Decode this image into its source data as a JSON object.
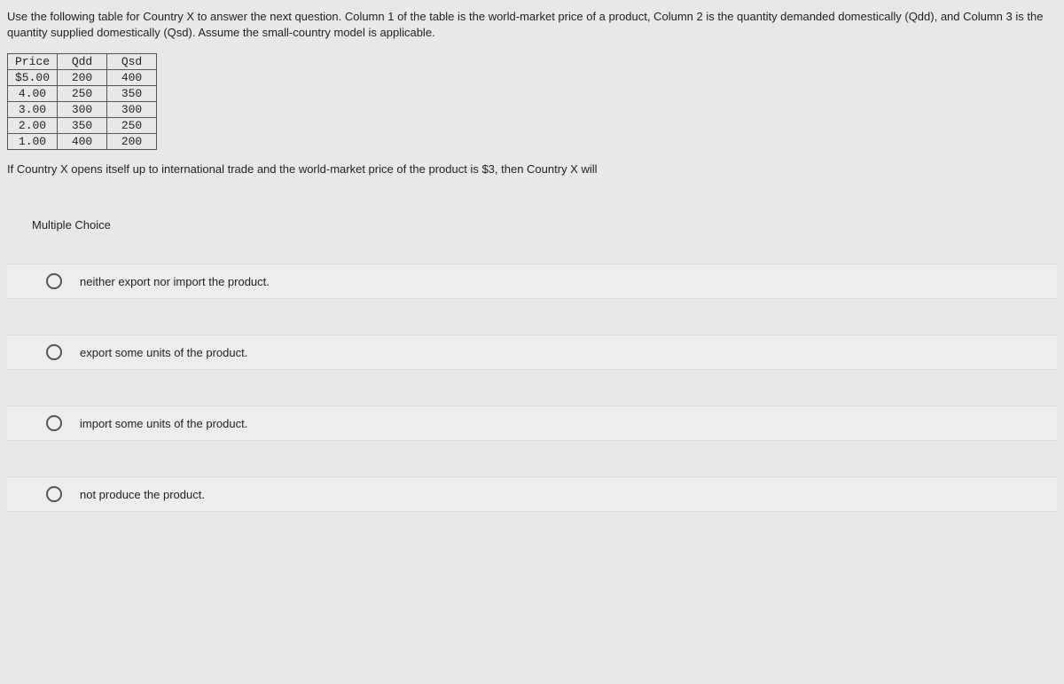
{
  "intro": "Use the following table for Country X to answer the next question. Column 1 of the table is the world-market price of a product, Column 2 is the quantity demanded domestically (Qdd), and Column 3 is the quantity supplied domestically (Qsd). Assume the small-country model is applicable.",
  "table": {
    "headers": [
      "Price",
      "Qdd",
      "Qsd"
    ],
    "rows": [
      [
        "$5.00",
        "200",
        "400"
      ],
      [
        "4.00",
        "250",
        "350"
      ],
      [
        "3.00",
        "300",
        "300"
      ],
      [
        "2.00",
        "350",
        "250"
      ],
      [
        "1.00",
        "400",
        "200"
      ]
    ]
  },
  "followup": "If Country X opens itself up to international trade and the world-market price of the product is $3, then Country X will",
  "mc_label": "Multiple Choice",
  "options": [
    "neither export nor import the product.",
    "export some units of the product.",
    "import some units of the product.",
    "not produce the product."
  ]
}
